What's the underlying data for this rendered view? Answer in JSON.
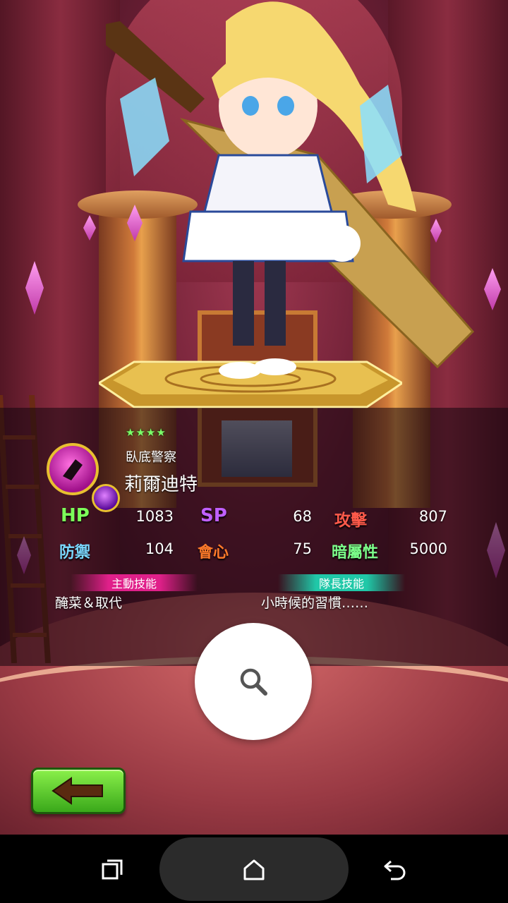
{
  "character": {
    "stars": "★★★★",
    "subtitle": "臥底警察",
    "name": "莉爾迪特"
  },
  "stats": {
    "hp_label": "HP",
    "hp": "1083",
    "sp_label": "SP",
    "sp": "68",
    "atk_label": "攻擊",
    "atk": "807",
    "def_label": "防禦",
    "def": "104",
    "crit_label": "會心",
    "crit": "75",
    "attr_label": "暗屬性",
    "attr": "5000"
  },
  "skills": {
    "active_header": "主動技能",
    "active_name": "醃菜＆取代",
    "leader_header": "隊長技能",
    "leader_name": "小時候的習慣……"
  },
  "colors": {
    "hp": "#7cff5a",
    "sp": "#c060ff",
    "atk": "#ff5a4a",
    "def": "#7ad8ff",
    "crit": "#ff7a2a",
    "attr": "#7cff8a"
  },
  "icons": {
    "zoom": "magnifier-icon",
    "back": "left-arrow-icon",
    "recents": "recent-apps-icon",
    "home": "home-icon",
    "nav_back": "back-icon"
  }
}
